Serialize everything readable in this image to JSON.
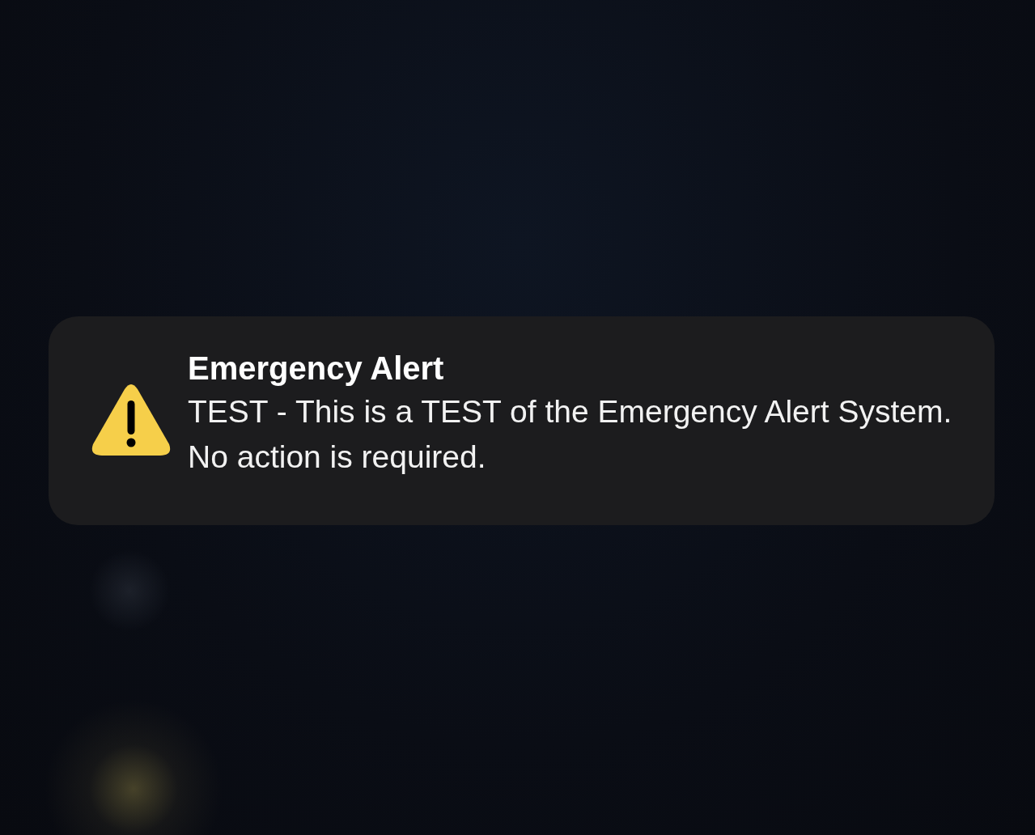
{
  "notification": {
    "title": "Emergency Alert",
    "message": "TEST - This is a TEST of the Emergency Alert System. No action is required."
  }
}
